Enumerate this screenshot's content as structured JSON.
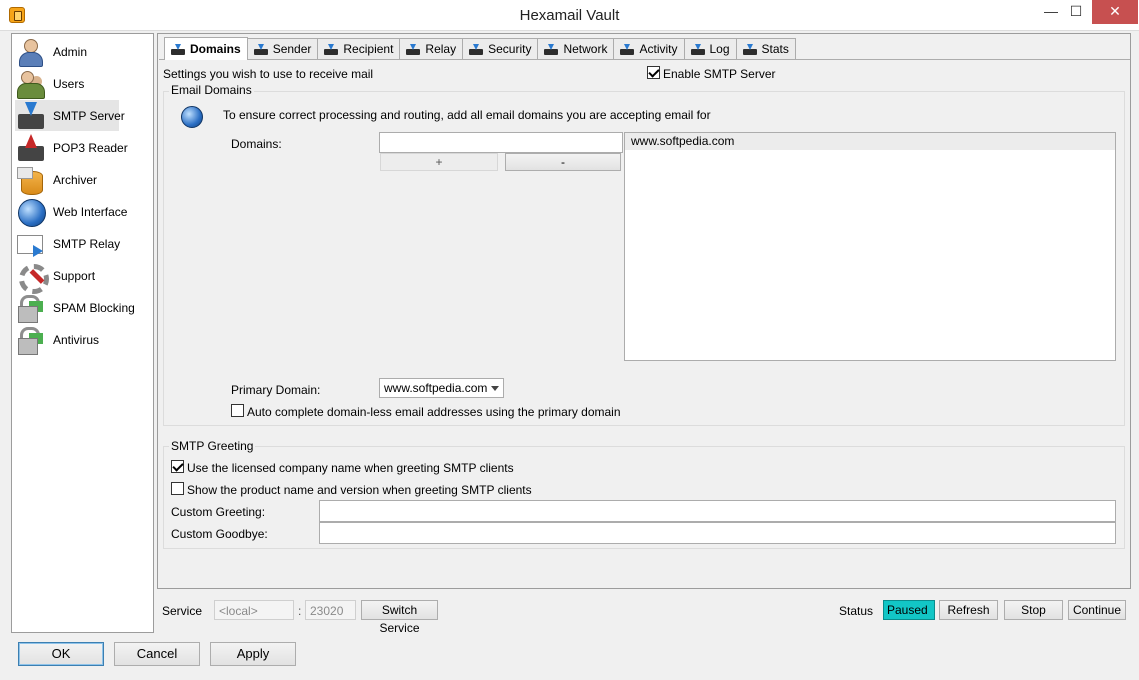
{
  "window": {
    "title": "Hexamail Vault",
    "minimize": "—",
    "maximize": "☐",
    "close": "✕"
  },
  "sidebar": {
    "items": [
      {
        "label": "Admin",
        "icon": "admin-icon"
      },
      {
        "label": "Users",
        "icon": "users-icon"
      },
      {
        "label": "SMTP Server",
        "icon": "smtp-server-icon"
      },
      {
        "label": "POP3 Reader",
        "icon": "pop3-reader-icon"
      },
      {
        "label": "Archiver",
        "icon": "archiver-icon"
      },
      {
        "label": "Web Interface",
        "icon": "web-interface-icon"
      },
      {
        "label": "SMTP Relay",
        "icon": "smtp-relay-icon"
      },
      {
        "label": "Support",
        "icon": "support-icon"
      },
      {
        "label": "SPAM Blocking",
        "icon": "spam-blocking-icon"
      },
      {
        "label": "Antivirus",
        "icon": "antivirus-icon"
      }
    ],
    "selected": "SMTP Server"
  },
  "tabs": [
    {
      "label": "Domains"
    },
    {
      "label": "Sender"
    },
    {
      "label": "Recipient"
    },
    {
      "label": "Relay"
    },
    {
      "label": "Security"
    },
    {
      "label": "Network"
    },
    {
      "label": "Activity"
    },
    {
      "label": "Log"
    },
    {
      "label": "Stats"
    }
  ],
  "domains": {
    "intro": "Settings you wish to use to receive mail",
    "enable_smtp_label": "Enable SMTP Server",
    "enable_smtp_checked": true,
    "email_domains_group": "Email Domains",
    "email_domains_desc": "To ensure correct processing and routing, add all email domains you are accepting email for",
    "domains_label": "Domains:",
    "domains_input_value": "",
    "add_button": "+",
    "remove_button": "-",
    "domain_list": [
      "www.softpedia.com"
    ],
    "primary_domain_label": "Primary Domain:",
    "primary_domain_value": "www.softpedia.com",
    "auto_complete_label": "Auto complete domain-less email addresses using the primary domain",
    "auto_complete_checked": false
  },
  "greeting": {
    "group": "SMTP Greeting",
    "use_licensed_label": "Use the licensed company name when greeting SMTP clients",
    "use_licensed_checked": true,
    "show_product_label": "Show the product name and version when greeting SMTP clients",
    "show_product_checked": false,
    "custom_greeting_label": "Custom Greeting:",
    "custom_greeting_value": "",
    "custom_goodbye_label": "Custom Goodbye:",
    "custom_goodbye_value": ""
  },
  "service": {
    "label": "Service",
    "host": "<local>",
    "colon": ":",
    "port": "23020",
    "switch_button": "Switch Service",
    "status_label": "Status",
    "status_value": "Paused",
    "status_color": "#12c6c6",
    "refresh_button": "Refresh",
    "stop_button": "Stop",
    "continue_button": "Continue"
  },
  "footer": {
    "ok_button": "OK",
    "cancel_button": "Cancel",
    "apply_button": "Apply"
  }
}
